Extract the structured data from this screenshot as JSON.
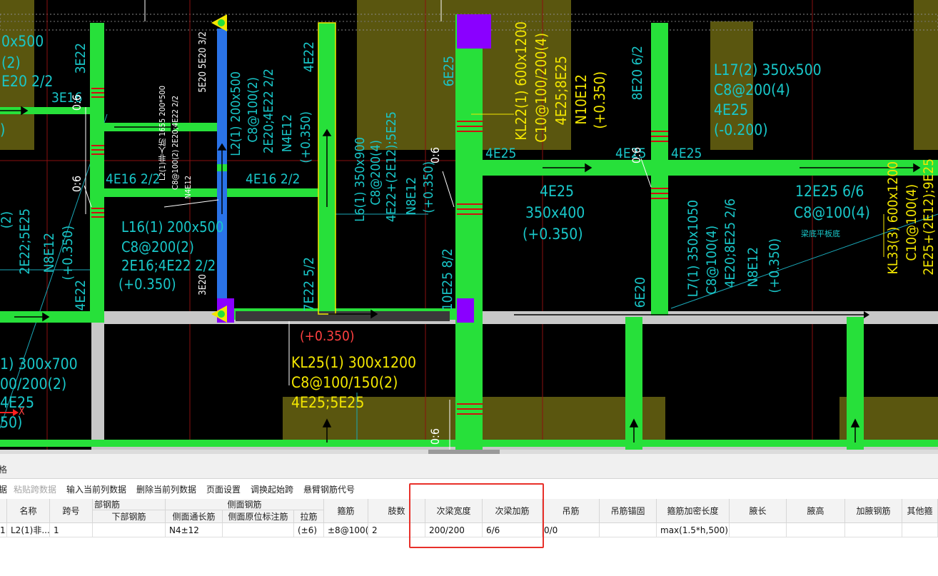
{
  "drawing": {
    "labels": [
      "0x500",
      "(2)",
      "E20 2/2",
      "3E16",
      "0:6",
      "3E22",
      ")",
      "0:6",
      "4E16 2/2",
      "4E22",
      "(2)",
      "2E22;5E25",
      "N8E12",
      "(+0.350)",
      "L16(1) 200x500",
      "C8@200(2)",
      "2E16;4E22 2/2",
      "(+0.350)",
      "L2(1)非人防 1655 200*500",
      "C8@100(2) 2E20;4E22 2/2",
      "N4E12",
      "5E20 5E20 3/2",
      "3E20",
      "L2(1) 200x500",
      "C8@100(2)",
      "2E20;4E22 2/2",
      "N4E12",
      "(+0.350)",
      "4E22",
      "4E16 2/2",
      "7E22 5/2",
      "L6(1) 350x900",
      "C8@200(4)",
      "4E22+(2E12);5E25",
      "N8E12",
      "(+0.350)",
      "0:6",
      "(+0.350)",
      "KL25(1) 300x1200",
      "C8@100/150(2)",
      "4E25;5E25",
      "6E25",
      "KL22(1) 600x1200",
      "C10@100/200(4)",
      "4E25;8E25",
      "N10E12",
      "(+0.350)",
      "4E25",
      "4E25",
      "350x400",
      "(+0.350)",
      "10E25 8/2",
      "0:6",
      "8E20 6/2",
      "4E25",
      "0:6",
      "4E25",
      "6E20",
      "L17(2) 350x500",
      "C8@200(4)",
      "4E25",
      "(-0.200)",
      "L7(1) 350x1050",
      "C8@100(4)",
      "4E20;8E25 2/6",
      "N8E12",
      "(+0.350)",
      "12E25 6/6",
      "C8@100(4)",
      "梁底平板底",
      "KL33(3) 600x1200",
      "C10@100(4)",
      "2E25+(2E12);9E25",
      "1) 300x700",
      "00/200(2)",
      "4E25",
      "50)",
      "X"
    ]
  },
  "panel": {
    "title": "格",
    "toolbar": {
      "items": [
        "据",
        "粘贴跨数据",
        "输入当前列数据",
        "删除当前列数据",
        "页面设置",
        "调换起始跨",
        "悬臂钢筋代号"
      ]
    }
  },
  "table": {
    "group_headers": {
      "bottom_rebar": "部钢筋",
      "side_rebar": "侧面钢筋"
    },
    "headers": {
      "name": "名称",
      "span": "跨号",
      "bottom_rebar": "下部钢筋",
      "side_through": "侧面通长筋",
      "side_note": "侧面原位标注筋",
      "tie": "拉筋",
      "stirrup": "箍筋",
      "legs": "肢数",
      "sec_width": "次梁宽度",
      "sec_add": "次梁加筋",
      "hanger": "吊筋",
      "hanger_anchor": "吊筋锚固",
      "dense_len": "箍筋加密长度",
      "haunch_len": "腋长",
      "haunch_h": "腋高",
      "haunch_rebar": "加腋钢筋",
      "other": "其他箍"
    },
    "row": {
      "idx": "1.",
      "name": "L2(1)非...",
      "span": "1",
      "bottom_rebar": "",
      "side_through": "N4±12",
      "side_note": "",
      "tie": "(±6)",
      "stirrup": "±8@100(",
      "legs": "2",
      "sec_width": "200/200",
      "sec_add": "6/6",
      "hanger": "0/0",
      "hanger_anchor": "",
      "dense_len": "max(1.5*h,500)",
      "haunch_len": "",
      "haunch_h": "",
      "haunch_rebar": "",
      "other": ""
    }
  },
  "colors": {
    "beam": "#27e03a",
    "cad_bg": "#000000",
    "text_teal": "#19c7c9",
    "text_yellow": "#f3e600",
    "highlight": "#e8302a",
    "purple": "#8a00ff"
  }
}
